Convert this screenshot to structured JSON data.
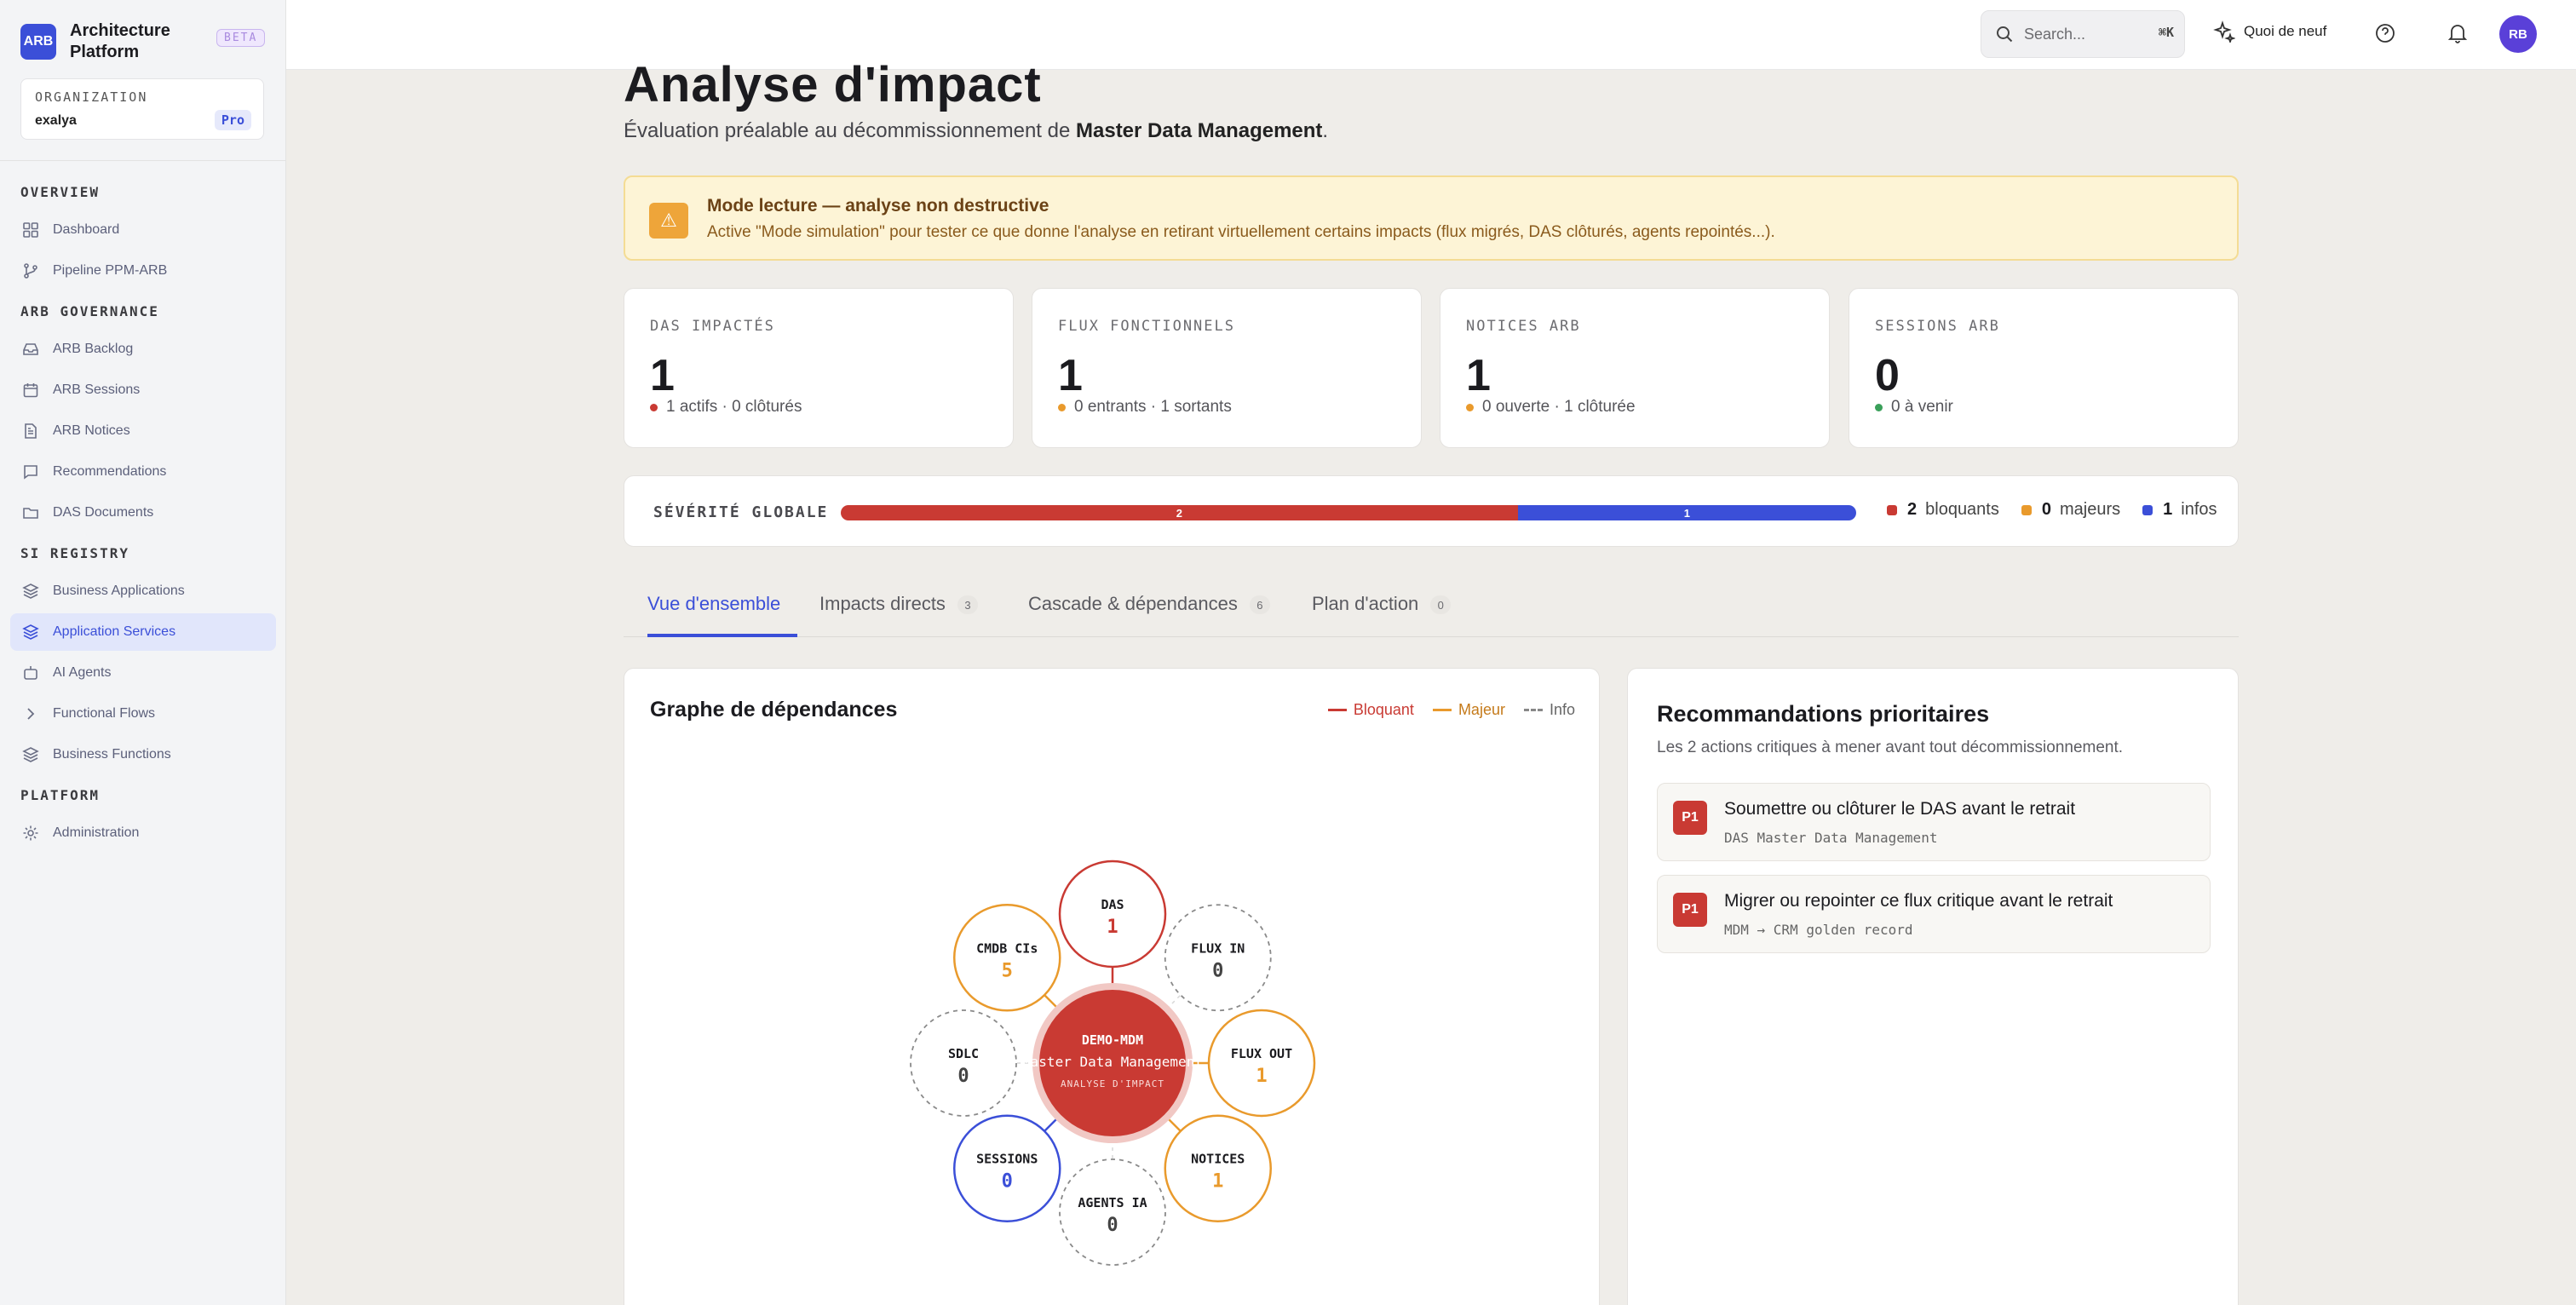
{
  "brand": {
    "logo": "ARB",
    "name": "Architecture Platform",
    "badge": "BETA"
  },
  "org": {
    "label": "ORGANIZATION",
    "name": "exalya",
    "plan": "Pro"
  },
  "nav": {
    "sections": [
      "OVERVIEW",
      "ARB GOVERNANCE",
      "SI REGISTRY",
      "PLATFORM"
    ],
    "items": [
      {
        "label": "Dashboard",
        "icon": "dashboard-icon"
      },
      {
        "label": "Pipeline PPM-ARB",
        "icon": "git-branch-icon"
      },
      {
        "label": "ARB Backlog",
        "icon": "inbox-icon"
      },
      {
        "label": "ARB Sessions",
        "icon": "calendar-icon"
      },
      {
        "label": "ARB Notices",
        "icon": "document-icon"
      },
      {
        "label": "Recommendations",
        "icon": "message-icon"
      },
      {
        "label": "DAS Documents",
        "icon": "folder-icon"
      },
      {
        "label": "Business Applications",
        "icon": "layers-icon"
      },
      {
        "label": "Application Services",
        "icon": "layers-icon",
        "active": true
      },
      {
        "label": "AI Agents",
        "icon": "bot-icon"
      },
      {
        "label": "Functional Flows",
        "icon": "chevron-right-icon"
      },
      {
        "label": "Business Functions",
        "icon": "layers-icon"
      },
      {
        "label": "Administration",
        "icon": "gear-icon"
      }
    ]
  },
  "topbar": {
    "search_placeholder": "Search...",
    "search_shortcut": "⌘K",
    "whats_new": "Quoi de neuf",
    "avatar_initials": "RB"
  },
  "page": {
    "title": "Analyse d'impact",
    "subtitle_prefix": "Évaluation préalable au décommissionnement de ",
    "subtitle_subject": "Master Data Management",
    "subtitle_suffix": "."
  },
  "alert": {
    "icon": "warning-icon",
    "title": "Mode lecture — analyse non destructive",
    "text": "Active \"Mode simulation\" pour tester ce que donne l'analyse en retirant virtuellement certains impacts (flux migrés, DAS clôturés, agents repointés...)."
  },
  "stats": [
    {
      "label": "DAS IMPACTÉS",
      "value": "1",
      "detail": "1 actifs · 0 clôturés",
      "color": "#c93a33"
    },
    {
      "label": "FLUX FONCTIONNELS",
      "value": "1",
      "detail": "0 entrants · 1 sortants",
      "color": "#e99a2c"
    },
    {
      "label": "NOTICES ARB",
      "value": "1",
      "detail": "0 ouverte · 1 clôturée",
      "color": "#e99a2c"
    },
    {
      "label": "SESSIONS ARB",
      "value": "0",
      "detail": "0 à venir",
      "color": "#3aa05a"
    }
  ],
  "severity": {
    "label": "SÉVÉRITÉ GLOBALE",
    "segments": [
      {
        "value": 2,
        "label": "2",
        "color": "#c93a33"
      },
      {
        "value": 1,
        "label": "1",
        "color": "#3b4fd8"
      }
    ],
    "legend": [
      {
        "count": "2",
        "label": "bloquants",
        "color": "#c93a33"
      },
      {
        "count": "0",
        "label": "majeurs",
        "color": "#e99a2c"
      },
      {
        "count": "1",
        "label": "infos",
        "color": "#3b4fd8"
      }
    ]
  },
  "tabs": [
    {
      "label": "Vue d'ensemble",
      "count": "",
      "active": true
    },
    {
      "label": "Impacts directs",
      "count": "3"
    },
    {
      "label": "Cascade & dépendances",
      "count": "6"
    },
    {
      "label": "Plan d'action",
      "count": "0"
    }
  ],
  "graph": {
    "title": "Graphe de dépendances",
    "legend": [
      {
        "label": "Bloquant",
        "color": "#c93a33",
        "style": "solid"
      },
      {
        "label": "Majeur",
        "color": "#e99a2c",
        "style": "solid"
      },
      {
        "label": "Info",
        "color": "#888888",
        "style": "dashed"
      }
    ],
    "center": {
      "code": "DEMO-MDM",
      "name": "Master Data Management",
      "caption": "ANALYSE D'IMPACT"
    },
    "nodes": [
      {
        "label": "DAS",
        "value": "1",
        "severity": "bloquant"
      },
      {
        "label": "FLUX IN",
        "value": "0",
        "severity": "none"
      },
      {
        "label": "FLUX OUT",
        "value": "1",
        "severity": "majeur"
      },
      {
        "label": "NOTICES",
        "value": "1",
        "severity": "majeur"
      },
      {
        "label": "AGENTS IA",
        "value": "0",
        "severity": "none"
      },
      {
        "label": "SESSIONS",
        "value": "0",
        "severity": "info"
      },
      {
        "label": "SDLC",
        "value": "0",
        "severity": "none"
      },
      {
        "label": "CMDB CIs",
        "value": "5",
        "severity": "majeur"
      }
    ],
    "colors": {
      "bloquant": "#c93a33",
      "majeur": "#e99a2c",
      "info": "#3b4fd8",
      "none": "#9a9a9a"
    }
  },
  "recommendations": {
    "title": "Recommandations prioritaires",
    "subtitle": "Les 2 actions critiques à mener avant tout décommissionnement.",
    "items": [
      {
        "priority": "P1",
        "title": "Soumettre ou clôturer le DAS avant le retrait",
        "meta": "DAS Master Data Management"
      },
      {
        "priority": "P1",
        "title": "Migrer ou repointer ce flux critique avant le retrait",
        "meta": "MDM → CRM golden record"
      }
    ]
  }
}
